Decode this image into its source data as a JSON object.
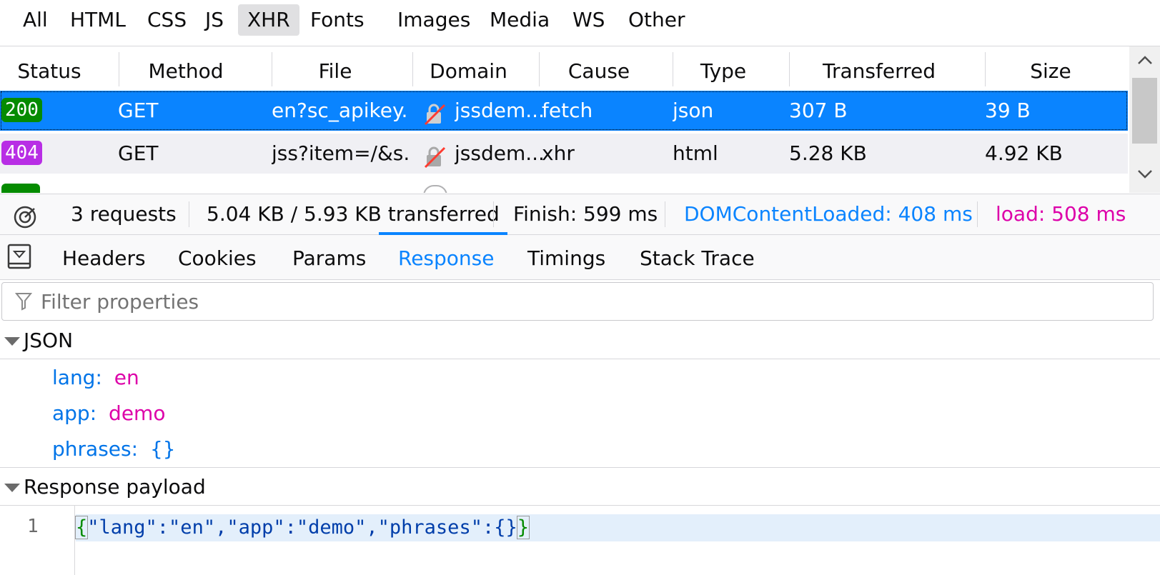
{
  "filters": [
    "All",
    "HTML",
    "CSS",
    "JS",
    "XHR",
    "Fonts",
    "Images",
    "Media",
    "WS",
    "Other"
  ],
  "active_filter": "XHR",
  "columns": [
    "Status",
    "Method",
    "File",
    "Domain",
    "Cause",
    "Type",
    "Transferred",
    "Size"
  ],
  "requests": [
    {
      "status": "200",
      "status_color": "#058b00",
      "method": "GET",
      "file": "en?sc_apikey...",
      "domain": "jssdem...",
      "cause": "fetch",
      "type": "json",
      "transferred": "307 B",
      "size": "39 B",
      "selected": true
    },
    {
      "status": "404",
      "status_color": "#b82ee5",
      "method": "GET",
      "file": "jss?item=/&s...",
      "domain": "jssdem...",
      "cause": "xhr",
      "type": "html",
      "transferred": "5.28 KB",
      "size": "4.92 KB",
      "selected": false
    }
  ],
  "summary": {
    "requests": "3 requests",
    "transferred": "5.04 KB / 5.93 KB transferred",
    "finish": "Finish: 599 ms",
    "dom_content_loaded": "DOMContentLoaded: 408 ms",
    "load": "load: 508 ms",
    "dcl_color": "#0a84ff",
    "load_color": "#dd00a9"
  },
  "detail_tabs": [
    "Headers",
    "Cookies",
    "Params",
    "Response",
    "Timings",
    "Stack Trace"
  ],
  "active_tab": "Response",
  "filter_properties_placeholder": "Filter properties",
  "json_section": {
    "title": "JSON",
    "entries": [
      {
        "key": "lang:",
        "value": "en"
      },
      {
        "key": "app:",
        "value": "demo"
      },
      {
        "key": "phrases:",
        "value": "{}"
      }
    ]
  },
  "payload_section": {
    "title": "Response payload",
    "line_number": "1",
    "open_brace": "{",
    "code": "\"lang\":\"en\",\"app\":\"demo\",\"phrases\":{}",
    "close_brace": "}"
  }
}
